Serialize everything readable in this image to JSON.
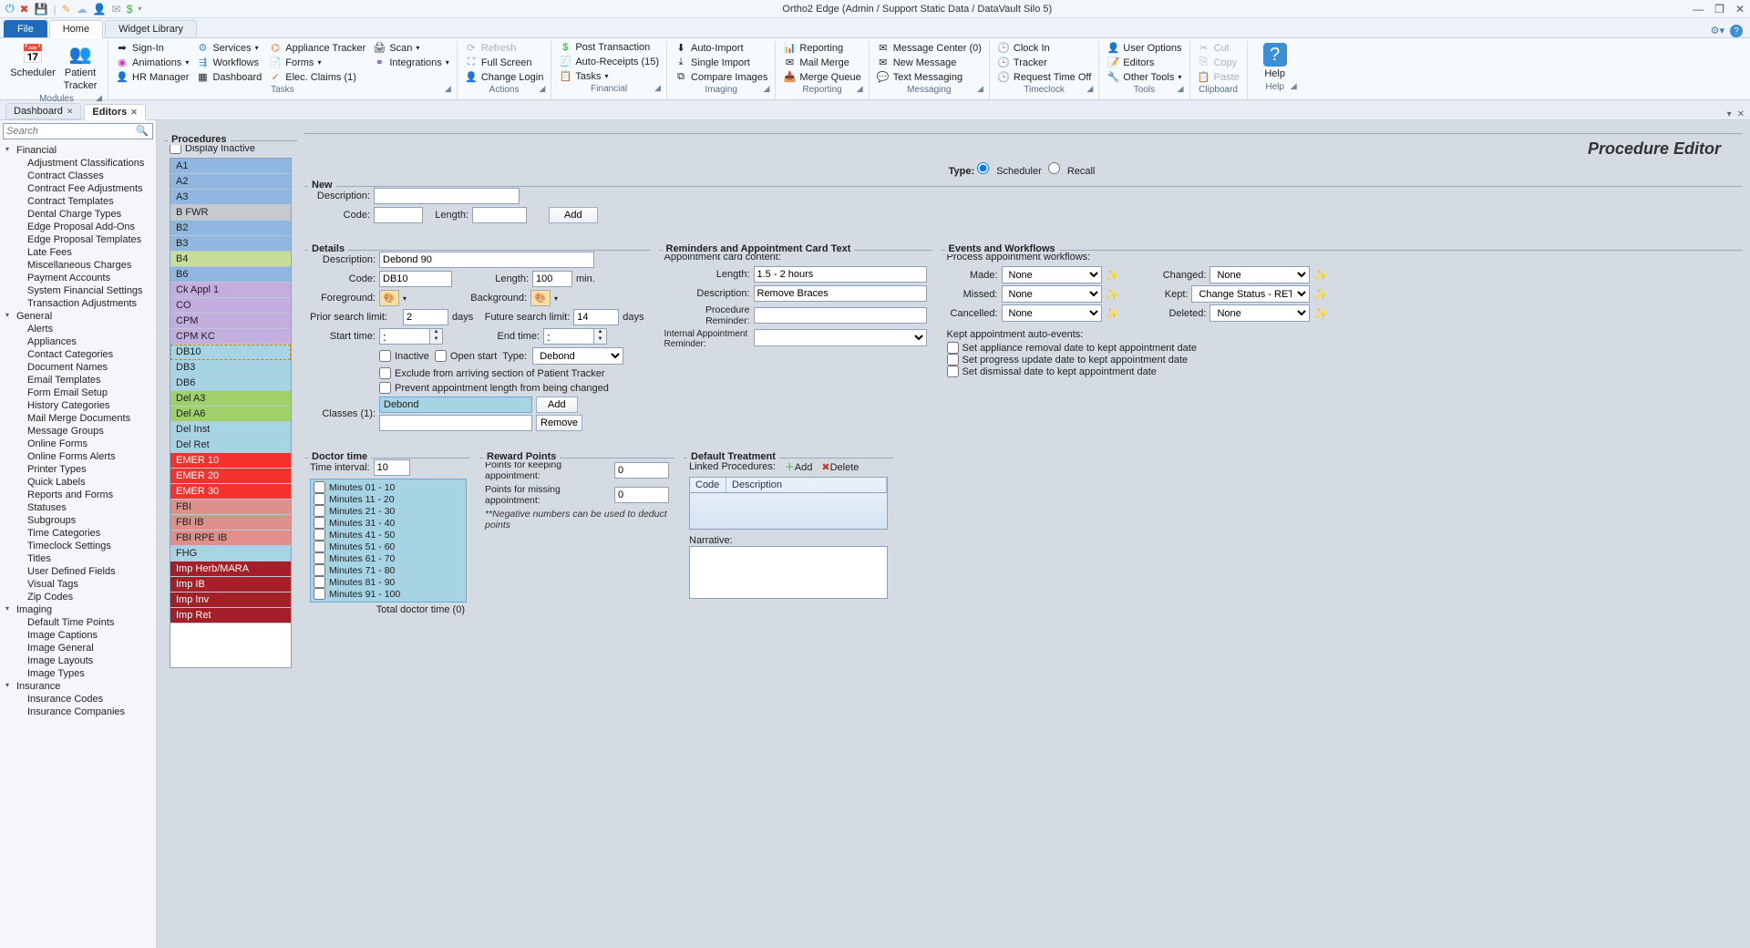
{
  "app": {
    "title": "Ortho2 Edge (Admin / Support Static Data / DataVault Silo 5)"
  },
  "tabs": {
    "file": "File",
    "home": "Home",
    "widget": "Widget Library"
  },
  "ribbon": {
    "modules": {
      "title": "Modules",
      "scheduler": "Scheduler",
      "tracker_l1": "Patient",
      "tracker_l2": "Tracker"
    },
    "tasks": {
      "title": "Tasks",
      "signin": "Sign-In",
      "animations": "Animations",
      "hr": "HR Manager",
      "services": "Services",
      "workflows": "Workflows",
      "dashboard": "Dashboard",
      "appliance": "Appliance Tracker",
      "forms": "Forms",
      "claims": "Elec. Claims (1)",
      "scan": "Scan",
      "integrations": "Integrations"
    },
    "actions": {
      "title": "Actions",
      "refresh": "Refresh",
      "full": "Full Screen",
      "change": "Change Login"
    },
    "financial": {
      "title": "Financial",
      "post": "Post Transaction",
      "auto": "Auto-Receipts (15)",
      "tasksmenu": "Tasks"
    },
    "imaging": {
      "title": "Imaging",
      "autoimport": "Auto-Import",
      "single": "Single Import",
      "compare": "Compare Images"
    },
    "reporting": {
      "title": "Reporting",
      "reporting": "Reporting",
      "merge": "Mail Merge",
      "queue": "Merge Queue"
    },
    "messaging": {
      "title": "Messaging",
      "center": "Message Center (0)",
      "newmsg": "New Message",
      "text": "Text Messaging"
    },
    "timeclock": {
      "title": "Timeclock",
      "clockin": "Clock In",
      "tracker": "Tracker",
      "rto": "Request Time Off"
    },
    "tools": {
      "title": "Tools",
      "user": "User Options",
      "editors": "Editors",
      "other": "Other Tools"
    },
    "clipboard": {
      "title": "Clipboard",
      "cut": "Cut",
      "copy": "Copy",
      "paste": "Paste"
    },
    "help": {
      "title": "Help",
      "help": "Help"
    }
  },
  "doctabs": {
    "dashboard": "Dashboard",
    "editors": "Editors"
  },
  "search": {
    "placeholder": "Search"
  },
  "tree": {
    "financial": {
      "label": "Financial",
      "items": [
        "Adjustment Classifications",
        "Contract Classes",
        "Contract Fee Adjustments",
        "Contract Templates",
        "Dental Charge Types",
        "Edge Proposal Add-Ons",
        "Edge Proposal Templates",
        "Late Fees",
        "Miscellaneous Charges",
        "Payment Accounts",
        "System Financial Settings",
        "Transaction Adjustments"
      ]
    },
    "general": {
      "label": "General",
      "items": [
        "Alerts",
        "Appliances",
        "Contact Categories",
        "Document Names",
        "Email Templates",
        "Form Email Setup",
        "History Categories",
        "Mail Merge Documents",
        "Message Groups",
        "Online Forms",
        "Online Forms Alerts",
        "Printer Types",
        "Quick Labels",
        "Reports and Forms",
        "Statuses",
        "Subgroups",
        "Time Categories",
        "Timeclock Settings",
        "Titles",
        "User Defined Fields",
        "Visual Tags",
        "Zip Codes"
      ]
    },
    "imaging": {
      "label": "Imaging",
      "items": [
        "Default Time Points",
        "Image Captions",
        "Image General",
        "Image Layouts",
        "Image Types"
      ]
    },
    "insurance": {
      "label": "Insurance",
      "items": [
        "Insurance Codes",
        "Insurance Companies"
      ]
    }
  },
  "proclist": {
    "legend": "Procedures",
    "display_inactive": "Display Inactive",
    "items": [
      {
        "t": "A1",
        "c": "#8fb7df"
      },
      {
        "t": "A2",
        "c": "#8fb7df"
      },
      {
        "t": "A3",
        "c": "#8fb7df"
      },
      {
        "t": "B FWR",
        "c": "#c6c9cd"
      },
      {
        "t": "B2",
        "c": "#8fb7df"
      },
      {
        "t": "B3",
        "c": "#8fb7df"
      },
      {
        "t": "B4",
        "c": "#c7dd9b"
      },
      {
        "t": "B6",
        "c": "#8fb7df"
      },
      {
        "t": "Ck Appl 1",
        "c": "#c4aee0"
      },
      {
        "t": "CO",
        "c": "#c4aee0"
      },
      {
        "t": "CPM",
        "c": "#c4aee0"
      },
      {
        "t": "CPM KC",
        "c": "#c4aee0"
      },
      {
        "t": "DB10",
        "c": "#a7d4e4",
        "sel": true
      },
      {
        "t": "DB3",
        "c": "#a7d4e4"
      },
      {
        "t": "DB6",
        "c": "#a7d4e4"
      },
      {
        "t": "Del A3",
        "c": "#9fd168"
      },
      {
        "t": "Del A6",
        "c": "#9fd168"
      },
      {
        "t": "Del Inst",
        "c": "#a7d4e4"
      },
      {
        "t": "Del Ret",
        "c": "#a7d4e4"
      },
      {
        "t": "EMER 10",
        "c": "#f3322e"
      },
      {
        "t": "EMER 20",
        "c": "#f3322e"
      },
      {
        "t": "EMER 30",
        "c": "#f3322e"
      },
      {
        "t": "FBI",
        "c": "#e08f8c"
      },
      {
        "t": "FBI IB",
        "c": "#e08f8c"
      },
      {
        "t": "FBI RPE IB",
        "c": "#e08f8c"
      },
      {
        "t": "FHG",
        "c": "#a7d4e4"
      },
      {
        "t": "Imp Herb/MARA",
        "c": "#a51f28"
      },
      {
        "t": "Imp IB",
        "c": "#a51f28"
      },
      {
        "t": "Imp Inv",
        "c": "#a51f28"
      },
      {
        "t": "Imp Ret",
        "c": "#a51f28"
      }
    ]
  },
  "editor": {
    "title": "Procedure Editor",
    "type_label": "Type:",
    "type_scheduler": "Scheduler",
    "type_recall": "Recall",
    "new": {
      "legend": "New",
      "description": "Description:",
      "code": "Code:",
      "length": "Length:",
      "add": "Add"
    },
    "details": {
      "legend": "Details",
      "description": "Description:",
      "description_v": "Debond 90",
      "code": "Code:",
      "code_v": "DB10",
      "length": "Length:",
      "length_v": "100",
      "min": "min.",
      "foreground": "Foreground:",
      "background": "Background:",
      "prior": "Prior search limit:",
      "prior_v": "2",
      "days": "days",
      "future": "Future search limit:",
      "future_v": "14",
      "start": "Start time:",
      "start_v": ":",
      "end": "End time:",
      "end_v": ":",
      "inactive": "Inactive",
      "open": "Open start",
      "type": "Type:",
      "type_v": "Debond",
      "exclude": "Exclude from arriving section of Patient Tracker",
      "prevent": "Prevent appointment length from being changed",
      "classes": "Classes (1):",
      "classes_v": "Debond",
      "add": "Add",
      "remove": "Remove"
    },
    "reminders": {
      "legend": "Reminders and Appointment Card Text",
      "cardcontent": "Appointment card content:",
      "length": "Length:",
      "length_v": "1.5 - 2 hours",
      "description": "Description:",
      "description_v": "Remove Braces",
      "procrem": "Procedure Reminder:",
      "intern": "Internal Appointment Reminder:"
    },
    "events": {
      "legend": "Events and Workflows",
      "process": "Process appointment workflows:",
      "made": "Made:",
      "missed": "Missed:",
      "cancelled": "Cancelled:",
      "changed": "Changed:",
      "kept": "Kept:",
      "deleted": "Deleted:",
      "none": "None",
      "kept_v": "Change Status - RET AC",
      "auto": "Kept appointment auto-events:",
      "a1": "Set appliance removal date to kept appointment date",
      "a2": "Set progress update date to kept appointment date",
      "a3": "Set dismissal date to kept appointment date"
    },
    "dtime": {
      "legend": "Doctor time",
      "interval": "Time interval:",
      "interval_v": "10",
      "rows": [
        "Minutes 01 - 10",
        "Minutes 11 - 20",
        "Minutes 21 - 30",
        "Minutes 31 - 40",
        "Minutes 41 - 50",
        "Minutes 51 - 60",
        "Minutes 61 - 70",
        "Minutes 71 - 80",
        "Minutes 81 - 90",
        "Minutes 91 - 100"
      ],
      "total": "Total doctor time (0)"
    },
    "rewards": {
      "legend": "Reward Points",
      "keep": "Points for keeping appointment:",
      "keep_v": "0",
      "miss": "Points for missing appointment:",
      "miss_v": "0",
      "note": "**Negative numbers can be used to deduct points"
    },
    "defaultt": {
      "legend": "Default Treatment",
      "linked": "Linked Procedures:",
      "add": "Add",
      "delete": "Delete",
      "col_code": "Code",
      "col_desc": "Description",
      "narrative": "Narrative:"
    }
  }
}
